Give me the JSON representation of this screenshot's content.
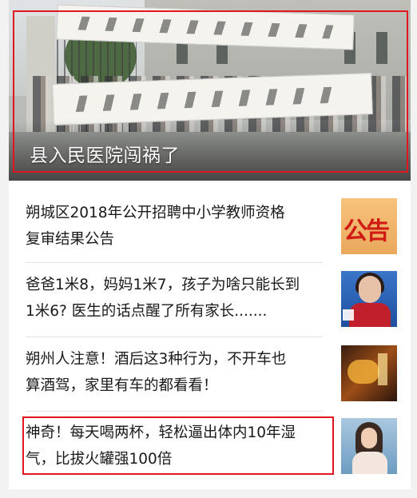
{
  "hero": {
    "caption": "县入民医院闯祸了",
    "image": "protest-banner-photo"
  },
  "articles": [
    {
      "title_line1": "朔城区2018年公开招聘中小学教师资格",
      "title_line2": "复审结果公告",
      "thumbnail": "announcement-poster",
      "thumbnail_text": "公告"
    },
    {
      "title_line1": "爸爸1米8，妈妈1米7，孩子为啥只能长到",
      "title_line2": "1米6? 医生的话点醒了所有家长.......",
      "thumbnail": "news-anchor"
    },
    {
      "title_line1": "朔州人注意！酒后这3种行为，不开车也",
      "title_line2": "算酒驾，家里有车的都看看！",
      "thumbnail": "drinking-scene"
    },
    {
      "title_line1": "神奇！每天喝两杯，轻松逼出体内10年湿",
      "title_line2": "气，比拔火罐强100倍",
      "thumbnail": "woman-portrait"
    }
  ],
  "colors": {
    "highlight": "#e0171e",
    "background": "#f2f2f2",
    "text": "#1a1a1a"
  }
}
